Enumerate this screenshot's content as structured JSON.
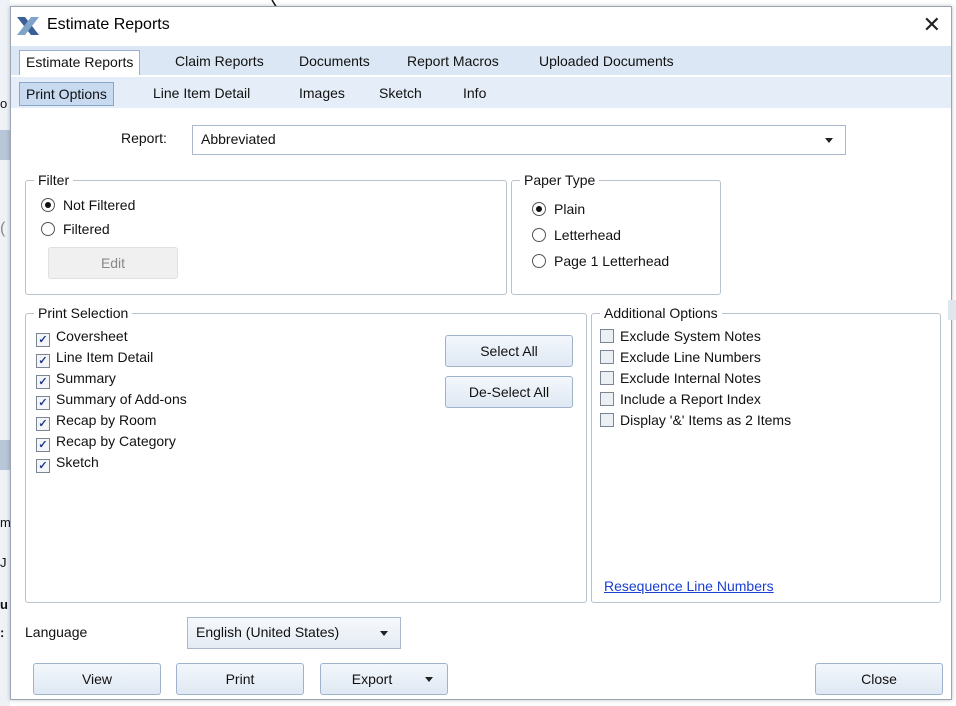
{
  "window": {
    "title": "Estimate Reports",
    "close_glyph": "✕"
  },
  "tabs_primary": [
    {
      "label": "Estimate Reports",
      "selected": true
    },
    {
      "label": "Claim Reports",
      "selected": false
    },
    {
      "label": "Documents",
      "selected": false
    },
    {
      "label": "Report Macros",
      "selected": false
    },
    {
      "label": "Uploaded Documents",
      "selected": false
    }
  ],
  "tabs_secondary": [
    {
      "label": "Print Options",
      "selected": true
    },
    {
      "label": "Line Item Detail",
      "selected": false
    },
    {
      "label": "Images",
      "selected": false
    },
    {
      "label": "Sketch",
      "selected": false
    },
    {
      "label": "Info",
      "selected": false
    }
  ],
  "report": {
    "label": "Report:",
    "value": "Abbreviated"
  },
  "filter": {
    "legend": "Filter",
    "options": [
      {
        "label": "Not Filtered",
        "selected": true
      },
      {
        "label": "Filtered",
        "selected": false
      }
    ],
    "edit_label": "Edit"
  },
  "paper_type": {
    "legend": "Paper Type",
    "options": [
      {
        "label": "Plain",
        "selected": true
      },
      {
        "label": "Letterhead",
        "selected": false
      },
      {
        "label": "Page 1 Letterhead",
        "selected": false
      }
    ]
  },
  "print_selection": {
    "legend": "Print Selection",
    "items": [
      {
        "label": "Coversheet",
        "checked": true
      },
      {
        "label": "Line Item Detail",
        "checked": true
      },
      {
        "label": "Summary",
        "checked": true
      },
      {
        "label": "Summary of Add-ons",
        "checked": true
      },
      {
        "label": "Recap by Room",
        "checked": true
      },
      {
        "label": "Recap by Category",
        "checked": true
      },
      {
        "label": "Sketch",
        "checked": true
      }
    ],
    "select_all": "Select All",
    "deselect_all": "De-Select All"
  },
  "additional_options": {
    "legend": "Additional Options",
    "items": [
      {
        "label": "Exclude System Notes",
        "checked": false
      },
      {
        "label": "Exclude Line Numbers",
        "checked": false
      },
      {
        "label": "Exclude Internal Notes",
        "checked": false
      },
      {
        "label": "Include a Report Index",
        "checked": false
      },
      {
        "label": "Display '&' Items as 2 Items",
        "checked": false
      }
    ],
    "resequence_link": "Resequence Line Numbers"
  },
  "language": {
    "label": "Language",
    "value": "English (United States)"
  },
  "footer": {
    "view": "View",
    "print": "Print",
    "export": "Export",
    "close": "Close"
  },
  "background_fragments": [
    "o",
    "(",
    "m",
    "J",
    "u",
    ":"
  ]
}
